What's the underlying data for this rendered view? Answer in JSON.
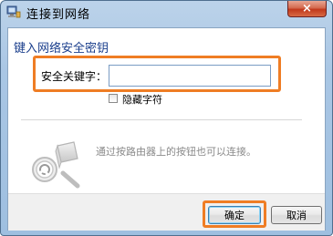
{
  "window": {
    "title": "连接到网络",
    "close_label": "×"
  },
  "dialog": {
    "heading": "键入网络安全密钥",
    "security_key_label": "安全关键字：",
    "security_key_value": "",
    "hide_chars_label": "隐藏字符",
    "hide_chars_checked": false,
    "router_hint": "通过按路由器上的按钮也可以连接。"
  },
  "buttons": {
    "ok_label": "确定",
    "cancel_label": "取消"
  },
  "colors": {
    "highlight": "#ef7d24",
    "heading": "#1a3e8c",
    "close_button": "#c1391b"
  }
}
